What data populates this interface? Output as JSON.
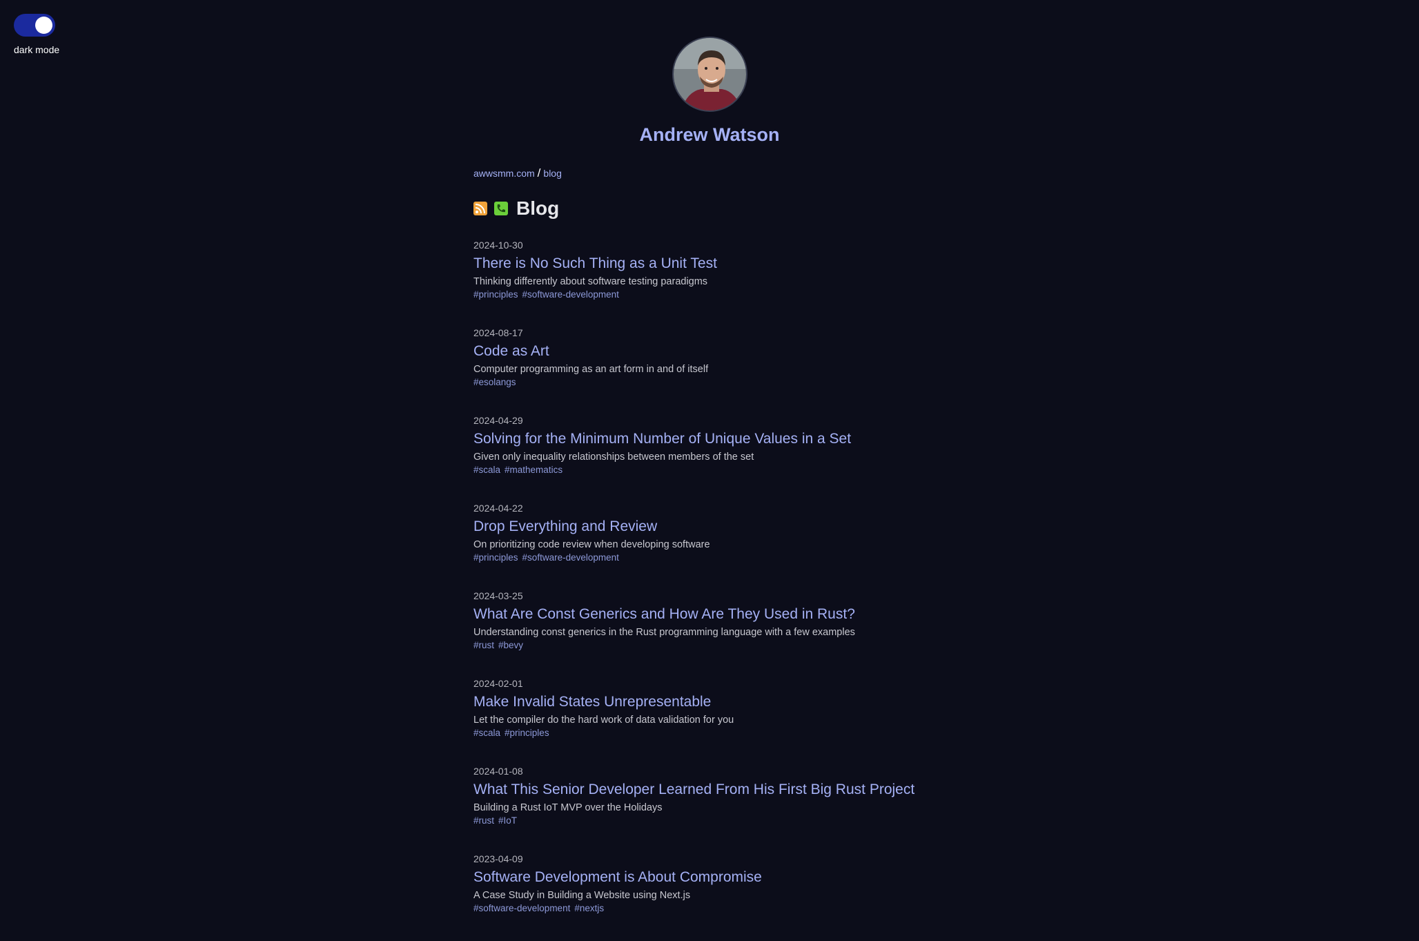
{
  "theme_toggle": {
    "label": "dark mode",
    "state": "on",
    "accent": "#1b2a9e"
  },
  "profile": {
    "name": "Andrew Watson",
    "avatar_icon": "profile-photo"
  },
  "breadcrumb": {
    "home": "awwsmm.com",
    "separator": "/",
    "current": "blog"
  },
  "section": {
    "title": "Blog",
    "icons": [
      "rss-icon",
      "phone-icon"
    ]
  },
  "posts": [
    {
      "date": "2024-10-30",
      "title": "There is No Such Thing as a Unit Test",
      "description": "Thinking differently about software testing paradigms",
      "tags": [
        "#principles",
        "#software-development"
      ]
    },
    {
      "date": "2024-08-17",
      "title": "Code as Art",
      "description": "Computer programming as an art form in and of itself",
      "tags": [
        "#esolangs"
      ]
    },
    {
      "date": "2024-04-29",
      "title": "Solving for the Minimum Number of Unique Values in a Set",
      "description": "Given only inequality relationships between members of the set",
      "tags": [
        "#scala",
        "#mathematics"
      ]
    },
    {
      "date": "2024-04-22",
      "title": "Drop Everything and Review",
      "description": "On prioritizing code review when developing software",
      "tags": [
        "#principles",
        "#software-development"
      ]
    },
    {
      "date": "2024-03-25",
      "title": "What Are Const Generics and How Are They Used in Rust?",
      "description": "Understanding const generics in the Rust programming language with a few examples",
      "tags": [
        "#rust",
        "#bevy"
      ]
    },
    {
      "date": "2024-02-01",
      "title": "Make Invalid States Unrepresentable",
      "description": "Let the compiler do the hard work of data validation for you",
      "tags": [
        "#scala",
        "#principles"
      ]
    },
    {
      "date": "2024-01-08",
      "title": "What This Senior Developer Learned From His First Big Rust Project",
      "description": "Building a Rust IoT MVP over the Holidays",
      "tags": [
        "#rust",
        "#IoT"
      ]
    },
    {
      "date": "2023-04-09",
      "title": "Software Development is About Compromise",
      "description": "A Case Study in Building a Website using Next.js",
      "tags": [
        "#software-development",
        "#nextjs"
      ]
    }
  ]
}
